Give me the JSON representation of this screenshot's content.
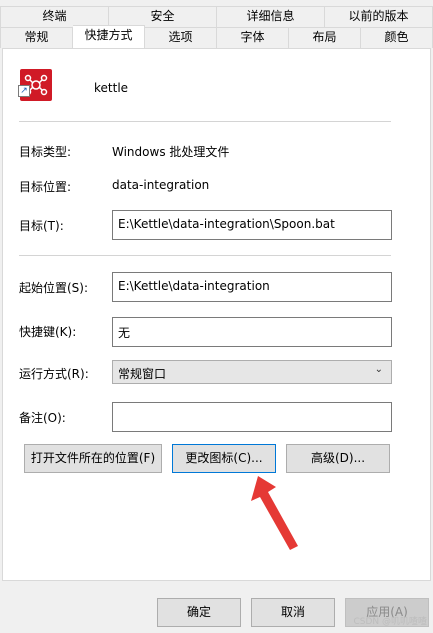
{
  "tabs_row1": [
    "终端",
    "安全",
    "详细信息",
    "以前的版本"
  ],
  "tabs_row2": [
    "常规",
    "快捷方式",
    "选项",
    "字体",
    "布局",
    "颜色"
  ],
  "shortcut": {
    "name": "kettle",
    "target_type_label": "目标类型:",
    "target_type_value": "Windows 批处理文件",
    "target_location_label": "目标位置:",
    "target_location_value": "data-integration",
    "target_label": "目标(T):",
    "target_value": "E:\\Kettle\\data-integration\\Spoon.bat",
    "start_in_label": "起始位置(S):",
    "start_in_value": "E:\\Kettle\\data-integration",
    "shortcut_key_label": "快捷键(K):",
    "shortcut_key_value": "无",
    "run_label": "运行方式(R):",
    "run_value": "常规窗口",
    "comment_label": "备注(O):",
    "comment_value": ""
  },
  "buttons": {
    "open_location": "打开文件所在的位置(F)",
    "change_icon": "更改图标(C)...",
    "advanced": "高级(D)..."
  },
  "dialog_buttons": {
    "ok": "确定",
    "cancel": "取消",
    "apply": "应用(A)"
  },
  "watermark": "CSDN @叽叽喳喳",
  "colors": {
    "accent": "#0078d7",
    "arrow": "#e53935",
    "icon_red": "#d01a26"
  }
}
